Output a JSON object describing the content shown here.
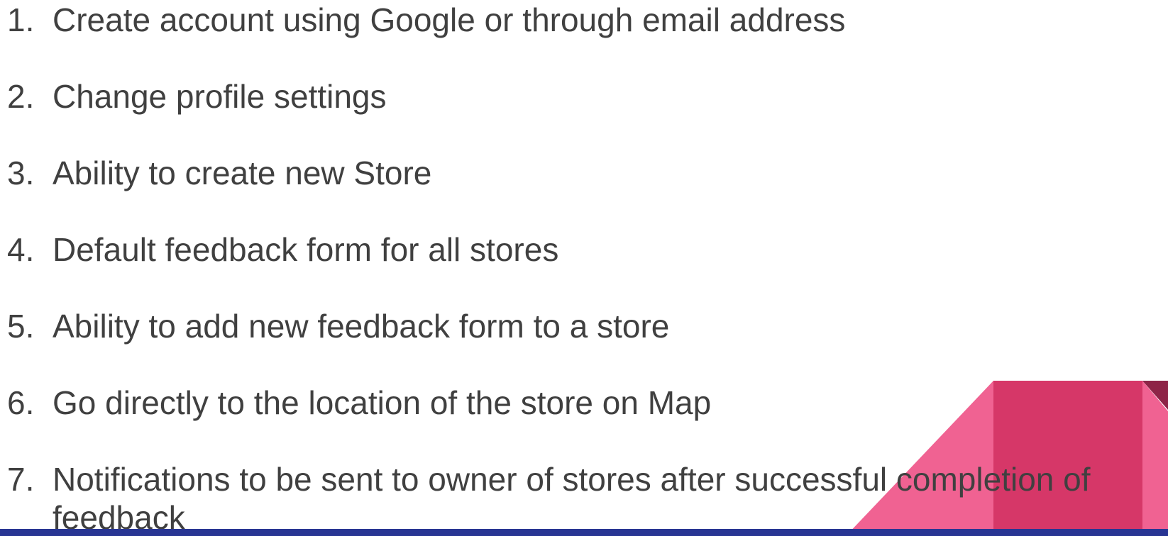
{
  "slide": {
    "items": [
      {
        "number": "1.",
        "text": "Create account using Google or through email address",
        "continuation": ""
      },
      {
        "number": "2.",
        "text": "Change profile settings",
        "continuation": ""
      },
      {
        "number": "3.",
        "text": "Ability to create new Store",
        "continuation": ""
      },
      {
        "number": "4.",
        "text": "Default feedback form for all stores",
        "continuation": ""
      },
      {
        "number": "5.",
        "text": "Ability to add new feedback form to a store",
        "continuation": ""
      },
      {
        "number": "6.",
        "text": "Go directly to the location of the store on Map",
        "continuation": ""
      },
      {
        "number": "7.",
        "text": "Notifications to be sent to owner of stores after successful completion of",
        "continuation": "feedback"
      }
    ]
  },
  "colors": {
    "text": "#404040",
    "pink_light": "#f06292",
    "pink_dark": "#d63768",
    "maroon": "#8e2447",
    "bottom_bar": "#283593"
  }
}
